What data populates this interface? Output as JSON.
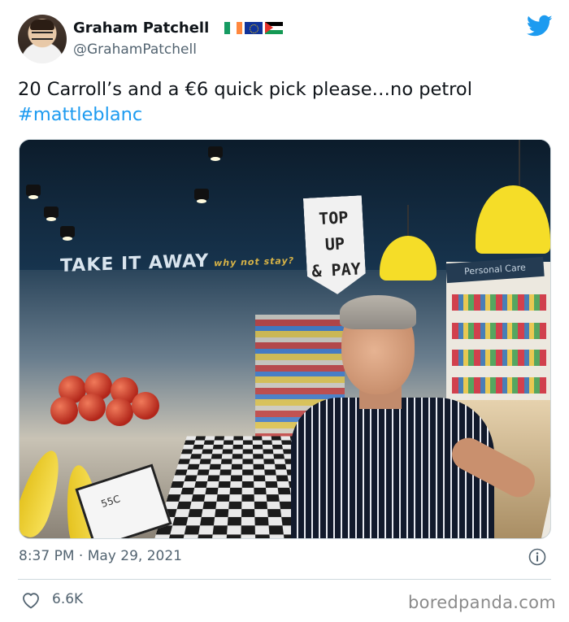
{
  "author": {
    "display_name": "Graham Patchell",
    "handle": "@GrahamPatchell",
    "flags": [
      "ireland-flag",
      "eu-flag",
      "palestine-flag"
    ]
  },
  "tweet": {
    "text": "20 Carroll’s and a €6 quick pick please…no petrol",
    "hashtag": "#mattleblanc"
  },
  "photo": {
    "wall_sign": "TAKE IT AWAY",
    "wall_sign_sub": "why not stay?",
    "topup_sign_line1": "TOP UP",
    "topup_sign_line2": "& PAY",
    "care_sign": "Personal Care",
    "price_tag": "55C"
  },
  "timestamp": "8:37 PM · May 29, 2021",
  "likes": "6.6K",
  "watermark": "boredpanda.com",
  "colors": {
    "twitter_blue": "#1d9bf0",
    "text_primary": "#0f1419",
    "text_secondary": "#536471",
    "divider": "#cfd9de"
  }
}
